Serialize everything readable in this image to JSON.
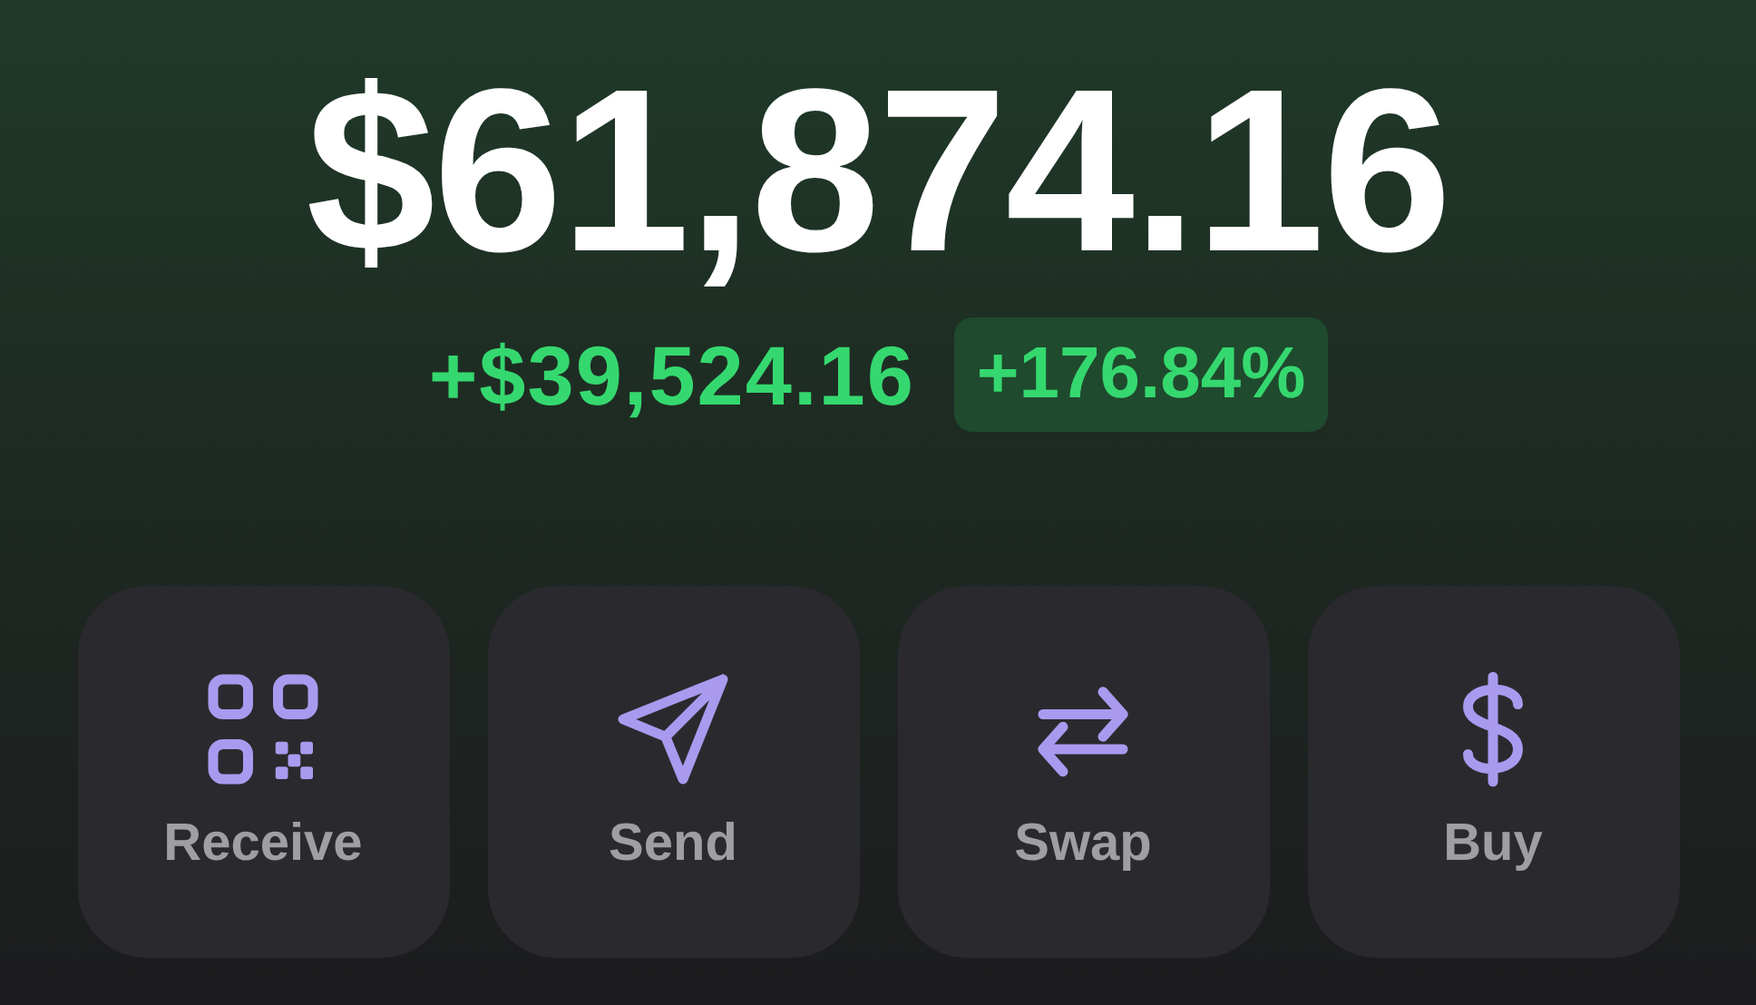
{
  "balance": "$61,874.16",
  "change": {
    "amount": "+$39,524.16",
    "percent": "+176.84%"
  },
  "actions": [
    {
      "kind": "receive",
      "label": "Receive"
    },
    {
      "kind": "send",
      "label": "Send"
    },
    {
      "kind": "swap",
      "label": "Swap"
    },
    {
      "kind": "buy",
      "label": "Buy"
    }
  ]
}
